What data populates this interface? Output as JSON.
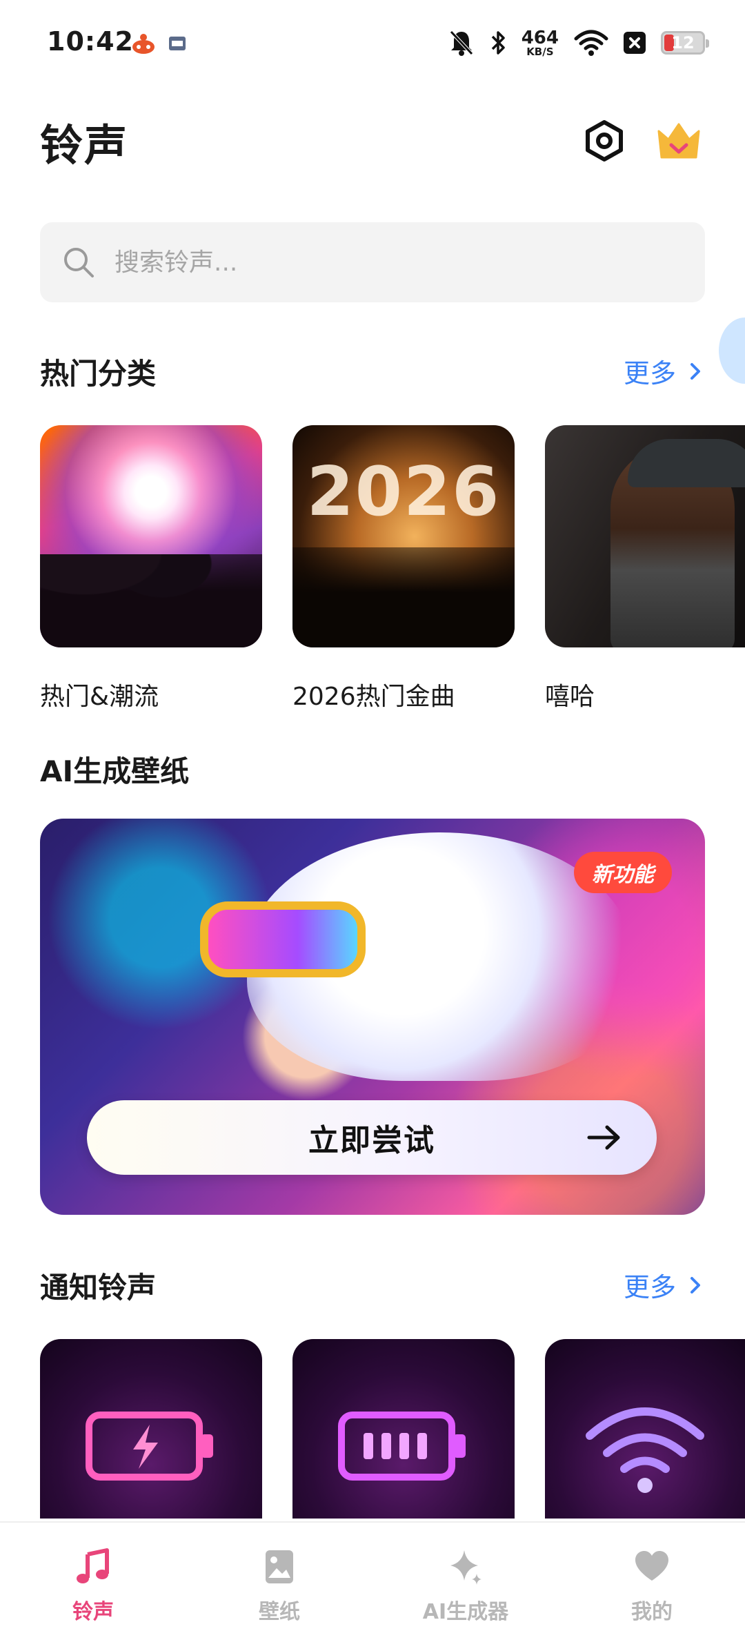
{
  "status_bar": {
    "time": "10:42",
    "net_speed_value": "464",
    "net_speed_unit": "KB/S",
    "battery_level": "12",
    "icons": [
      "app-notification-icon",
      "app-notification-icon-2",
      "bell-muted-icon",
      "bluetooth-icon",
      "wifi-icon",
      "close-box-icon",
      "battery-icon"
    ]
  },
  "header": {
    "title": "铃声",
    "settings_icon": "settings-hexagon-icon",
    "vip_icon": "crown-icon"
  },
  "search": {
    "placeholder": "搜索铃声..."
  },
  "hot_categories": {
    "title": "热门分类",
    "more_label": "更多",
    "items": [
      {
        "label": "热门&潮流"
      },
      {
        "label": "2026热门金曲",
        "image_text": "2026"
      },
      {
        "label": "嘻哈"
      }
    ]
  },
  "ai_wallpaper": {
    "title": "AI生成壁纸",
    "badge": "新功能",
    "cta_label": "立即尝试"
  },
  "notification_ringtones": {
    "title": "通知铃声",
    "more_label": "更多",
    "items": [
      {
        "icon": "battery-charging-icon"
      },
      {
        "icon": "battery-full-icon"
      },
      {
        "icon": "wifi-icon"
      }
    ]
  },
  "bottom_nav": {
    "items": [
      {
        "label": "铃声",
        "icon": "music-note-icon",
        "active": true
      },
      {
        "label": "壁纸",
        "icon": "image-icon",
        "active": false
      },
      {
        "label": "AI生成器",
        "icon": "sparkle-icon",
        "active": false
      },
      {
        "label": "我的",
        "icon": "heart-icon",
        "active": false
      }
    ]
  },
  "colors": {
    "accent_pink": "#e8457a",
    "link_blue": "#3b82f6",
    "badge_red": "#ff4a3d",
    "crown_gold": "#f5b83a"
  }
}
